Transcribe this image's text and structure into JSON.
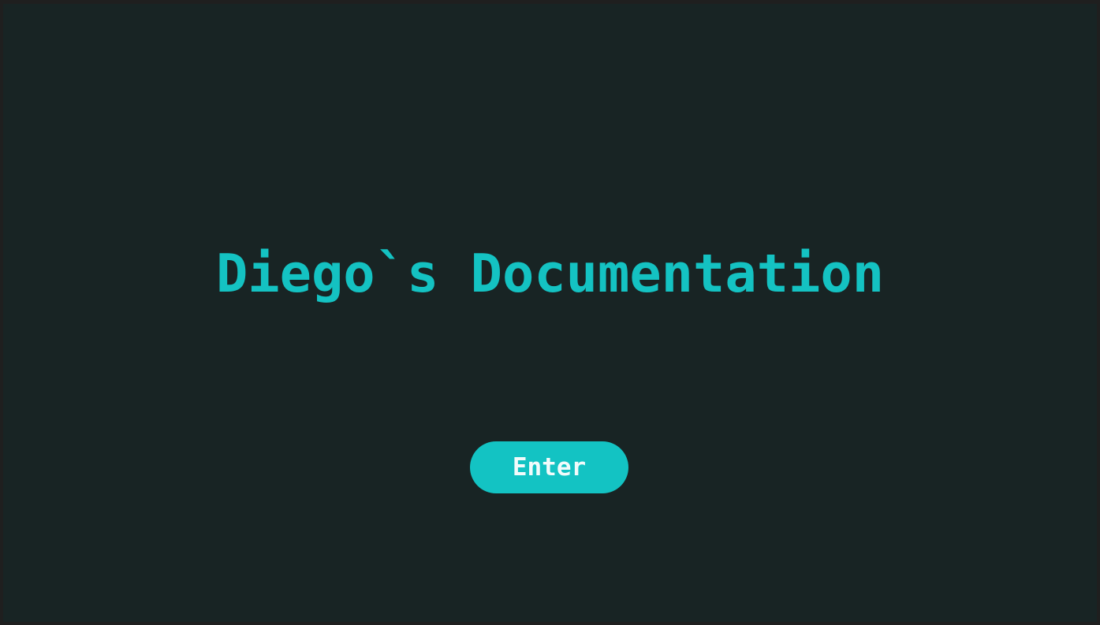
{
  "page": {
    "title": "Diego`s Documentation"
  },
  "actions": {
    "enter_label": "Enter"
  },
  "colors": {
    "background": "#182424",
    "frame": "#1f1f1f",
    "accent": "#14c2c2",
    "button_text": "#f2fbfb"
  }
}
